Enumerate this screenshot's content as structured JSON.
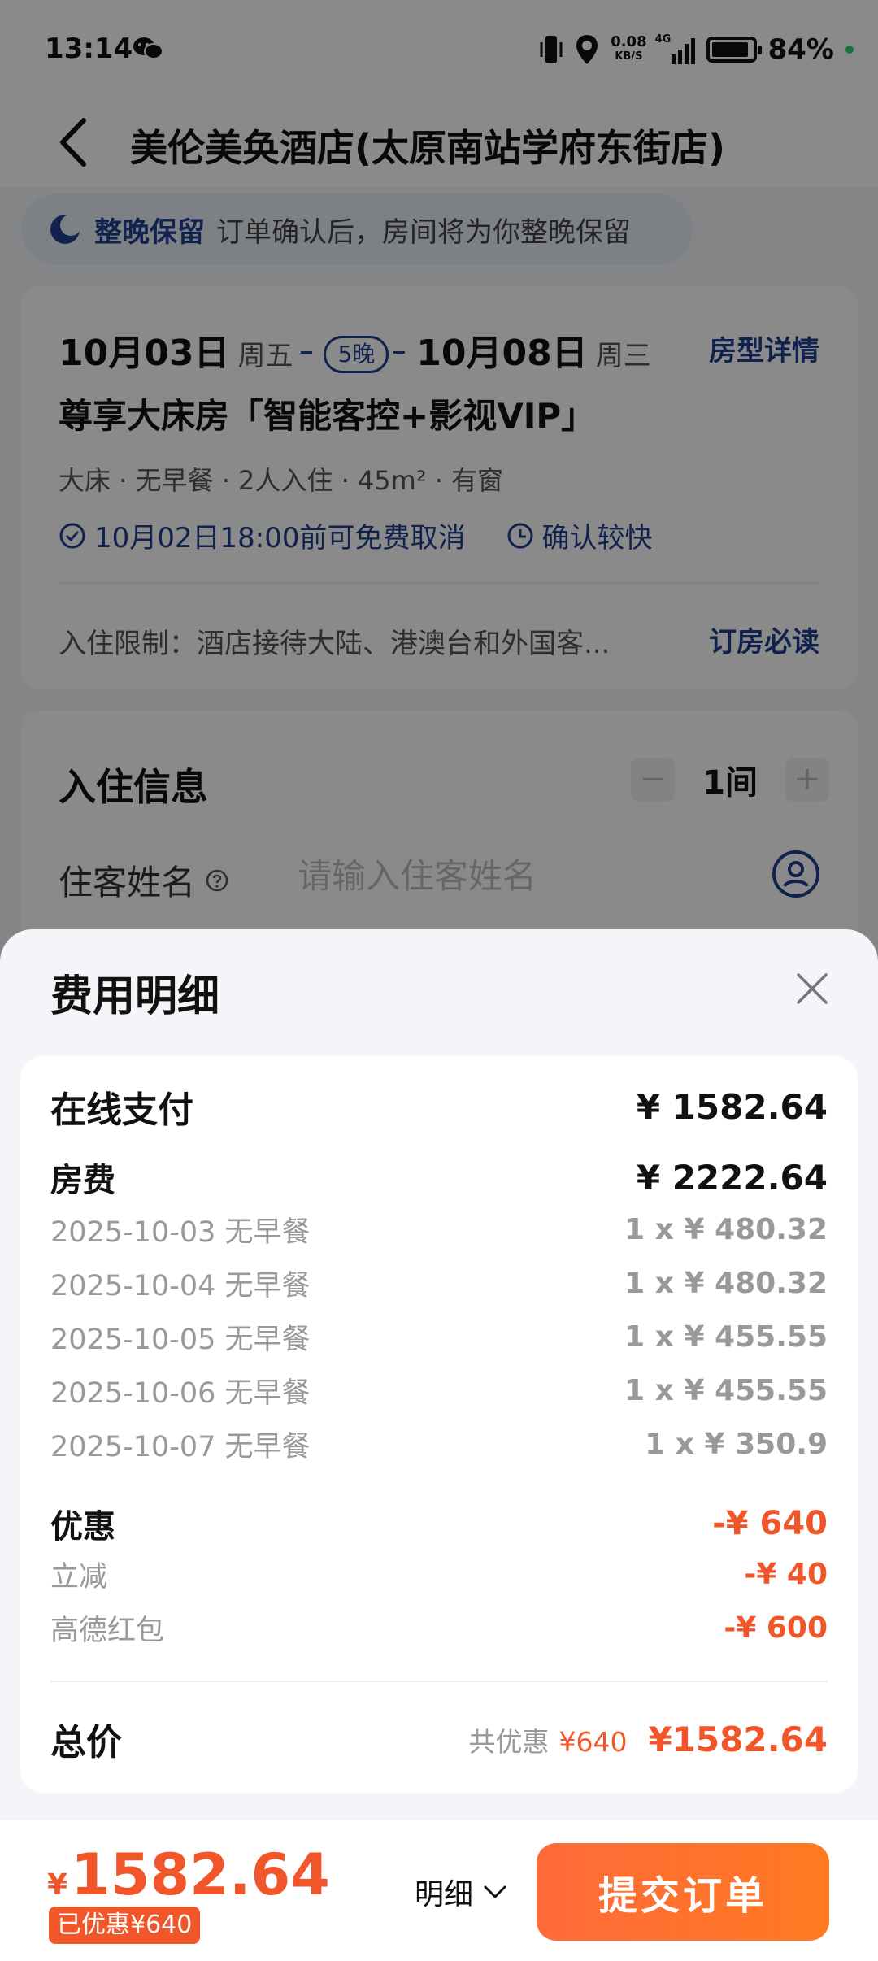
{
  "status_bar": {
    "time": "13:14",
    "net_speed": "0.08",
    "net_unit": "KB/S",
    "net_type": "4G",
    "battery": "84%"
  },
  "nav": {
    "title": "美伦美奂酒店(太原南站学府东街店)"
  },
  "keep_room": {
    "title": "整晚保留",
    "text": "订单确认后，房间将为你整晚保留"
  },
  "room_card": {
    "checkin_date": "10月03日",
    "checkin_week": "周五",
    "nights": "5晚",
    "checkout_date": "10月08日",
    "checkout_week": "周三",
    "detail_link": "房型详情",
    "room_name": "尊享大床房「智能客控+影视VIP」",
    "attrs": "大床 · 无早餐 · 2人入住 · 45m² · 有窗",
    "cancel_tag": "10月02日18:00前可免费取消",
    "confirm_tag": "确认较快",
    "restriction": "入住限制：酒店接待大陆、港澳台和外国客...",
    "must_read": "订房必读"
  },
  "checkin_info": {
    "title": "入住信息",
    "rooms": "1间",
    "minus": "−",
    "plus": "+",
    "guest_label": "住客姓名",
    "guest_placeholder": "请输入住客姓名"
  },
  "fee_sheet": {
    "title": "费用明细",
    "online_pay_label": "在线支付",
    "online_pay_value": "¥ 1582.64",
    "room_fee_label": "房费",
    "room_fee_value": "¥ 2222.64",
    "nights": [
      {
        "date": "2025-10-03 无早餐",
        "price": "1 x ¥ 480.32"
      },
      {
        "date": "2025-10-04 无早餐",
        "price": "1 x ¥ 480.32"
      },
      {
        "date": "2025-10-05 无早餐",
        "price": "1 x ¥ 455.55"
      },
      {
        "date": "2025-10-06 无早餐",
        "price": "1 x ¥ 455.55"
      },
      {
        "date": "2025-10-07 无早餐",
        "price": "1 x ¥ 350.9"
      }
    ],
    "discount_label": "优惠",
    "discount_value": "-¥ 640",
    "discounts": [
      {
        "label": "立减",
        "value": "-¥ 40"
      },
      {
        "label": "高德红包",
        "value": "-¥ 600"
      }
    ],
    "total_label": "总价",
    "total_saved_label": "共优惠",
    "total_saved_value": "¥640",
    "total_value": "¥1582.64"
  },
  "action_bar": {
    "currency": "¥",
    "price": "1582.64",
    "discount_badge": "已优惠¥640",
    "detail_toggle": "明细",
    "submit": "提交订单"
  },
  "colors": {
    "brand_blue": "#1f3f8f",
    "accent_orange": "#f0562a"
  }
}
